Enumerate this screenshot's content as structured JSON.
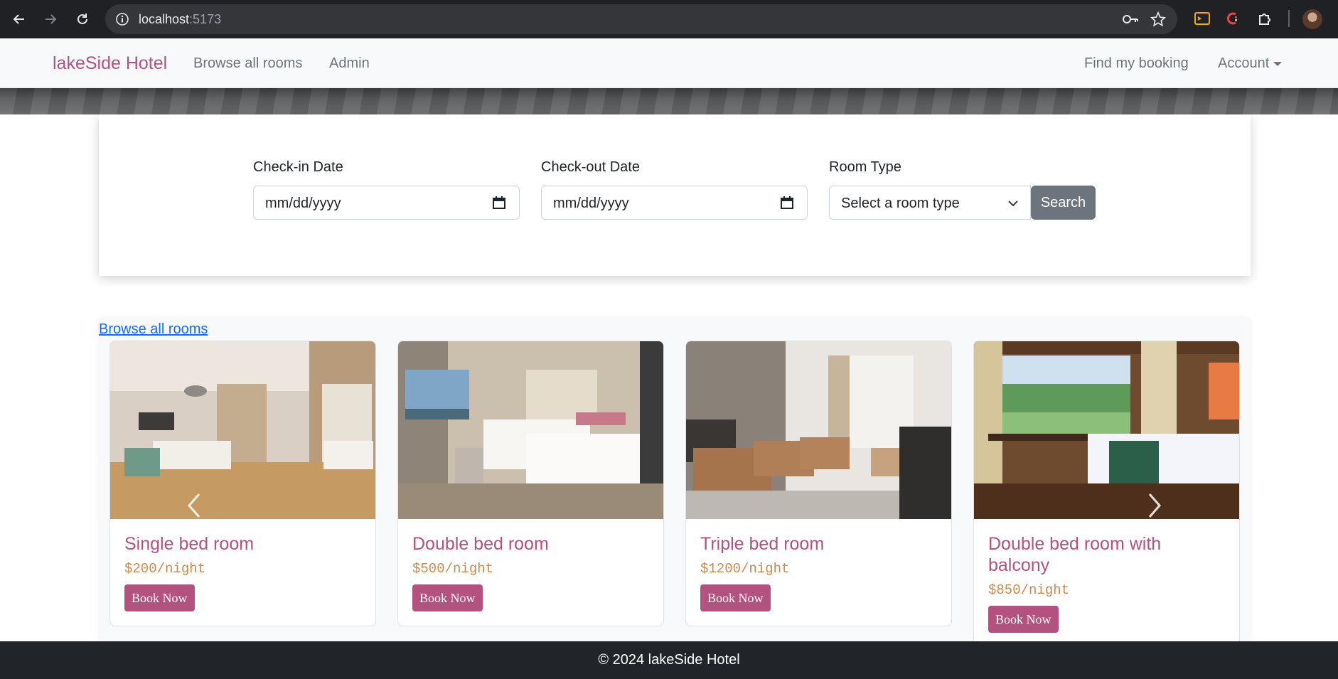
{
  "browser": {
    "url_host": "localhost",
    "url_port": ":5173"
  },
  "navbar": {
    "brand": "lakeSide Hotel",
    "links": [
      "Browse all rooms",
      "Admin"
    ],
    "right_links": [
      "Find my booking",
      "Account"
    ]
  },
  "search": {
    "checkin_label": "Check-in Date",
    "checkin_placeholder": "mm/dd/yyyy",
    "checkout_label": "Check-out Date",
    "checkout_placeholder": "mm/dd/yyyy",
    "roomtype_label": "Room Type",
    "roomtype_value": "Select a room type",
    "button": "Search"
  },
  "rooms": {
    "browse_link": "Browse all rooms",
    "cards": [
      {
        "title": "Single bed room",
        "price": "$200/night",
        "button": "Book Now"
      },
      {
        "title": "Double bed room",
        "price": "$500/night",
        "button": "Book Now"
      },
      {
        "title": "Triple bed room",
        "price": "$1200/night",
        "button": "Book Now"
      },
      {
        "title": "Double bed room with balcony",
        "price": "$850/night",
        "button": "Book Now"
      }
    ]
  },
  "footer": {
    "text": "© 2024 lakeSide Hotel"
  },
  "colors": {
    "brand": "#b3527f",
    "price": "#c98a4b",
    "search_button": "#6c757d",
    "footer_bg": "#212529"
  }
}
